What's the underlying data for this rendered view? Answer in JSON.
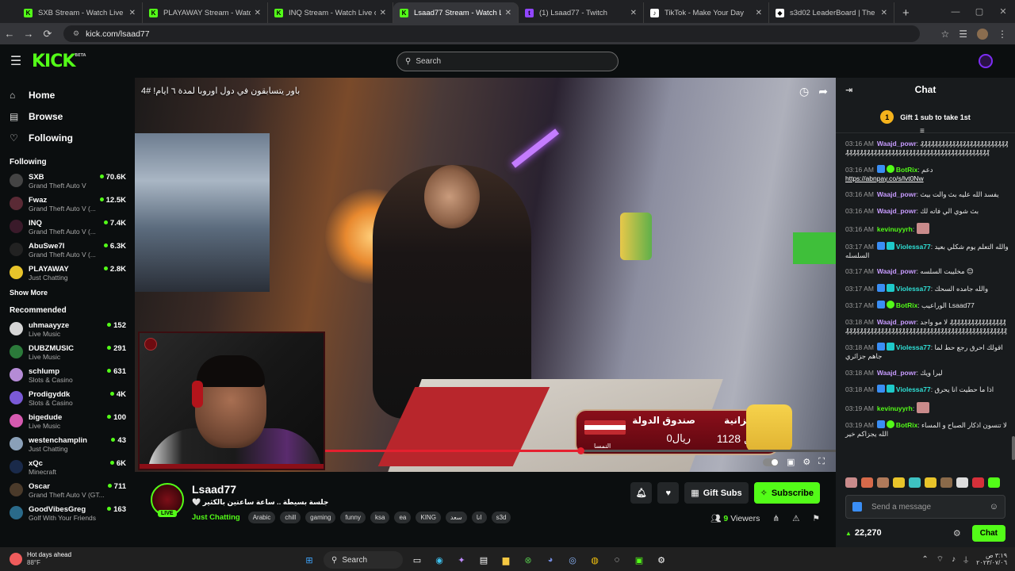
{
  "browser": {
    "tabs": [
      {
        "title": "SXB Stream - Watch Live on Kick",
        "fav": "K",
        "color": "#53fc18"
      },
      {
        "title": "PLAYAWAY Stream - Watch Live on Kick",
        "fav": "K",
        "color": "#53fc18"
      },
      {
        "title": "INQ Stream - Watch Live on Kick",
        "fav": "K",
        "color": "#53fc18"
      },
      {
        "title": "Lsaad77 Stream - Watch Live on Kick",
        "fav": "K",
        "color": "#53fc18"
      },
      {
        "title": "(1) Lsaad77 - Twitch",
        "fav": "t",
        "color": "#9146ff"
      },
      {
        "title": "TikTok - Make Your Day",
        "fav": "♪",
        "color": "#ffffff"
      },
      {
        "title": "s3d02 LeaderBoard | The best Leaderboard",
        "fav": "◆",
        "color": "#ffffff"
      }
    ],
    "url": "kick.com/lsaad77"
  },
  "header": {
    "logo": "KICK",
    "logo_beta": "BETA",
    "search_placeholder": "Search"
  },
  "sidebar": {
    "nav": [
      {
        "label": "Home",
        "icon": "home-icon"
      },
      {
        "label": "Browse",
        "icon": "browse-icon"
      },
      {
        "label": "Following",
        "icon": "heart-icon"
      }
    ],
    "following_title": "Following",
    "following": [
      {
        "name": "SXB",
        "category": "Grand Theft Auto V",
        "viewers": "70.6K",
        "color": "#444"
      },
      {
        "name": "Fwaz",
        "category": "Grand Theft Auto V (...",
        "viewers": "12.5K",
        "color": "#5a2a35"
      },
      {
        "name": "INQ",
        "category": "Grand Theft Auto V (...",
        "viewers": "7.4K",
        "color": "#3a1a2a"
      },
      {
        "name": "AbuSwe7l",
        "category": "Grand Theft Auto V (...",
        "viewers": "6.3K",
        "color": "#222"
      },
      {
        "name": "PLAYAWAY",
        "category": "Just Chatting",
        "viewers": "2.8K",
        "color": "#e8c42a"
      }
    ],
    "show_more": "Show More",
    "recommended_title": "Recommended",
    "recommended": [
      {
        "name": "uhmaayyze",
        "category": "Live Music",
        "viewers": "152",
        "color": "#d6d6d6"
      },
      {
        "name": "DUBZMUSIC",
        "category": "Live Music",
        "viewers": "291",
        "color": "#2b7a3a"
      },
      {
        "name": "schlump",
        "category": "Slots & Casino",
        "viewers": "631",
        "color": "#b58bd6"
      },
      {
        "name": "Prodigyddk",
        "category": "Slots & Casino",
        "viewers": "4K",
        "color": "#7a5ad6"
      },
      {
        "name": "bigedude",
        "category": "Live Music",
        "viewers": "100",
        "color": "#d65ab0"
      },
      {
        "name": "westenchamplin",
        "category": "Just Chatting",
        "viewers": "43",
        "color": "#8aa0b8"
      },
      {
        "name": "xQc",
        "category": "Minecraft",
        "viewers": "6K",
        "color": "#1a2a4a"
      },
      {
        "name": "Oscar",
        "category": "Grand Theft Auto V (GT...",
        "viewers": "711",
        "color": "#4a3a2a"
      },
      {
        "name": "GoodVibesGreg",
        "category": "Golf With Your Friends",
        "viewers": "163",
        "color": "#2a6a8a"
      }
    ]
  },
  "video": {
    "title": "باور يتسابقون في دول اوروبا لمدة ٦ ايام! #4",
    "overlay": {
      "treasury_label": "صندوق الدولة",
      "budget_label": "الميزانية",
      "treasury_value": "0ريال",
      "budget_value": "1128 ريال",
      "country": "النمسا"
    },
    "progress": 0.5
  },
  "stream": {
    "name": "Lsaad77",
    "live": "LIVE",
    "title": "جلسة بسيطة .. ساعة ساعتين بالكثير 🤍",
    "category": "Just Chatting",
    "tags": [
      "Arabic",
      "chill",
      "gaming",
      "funny",
      "ksa",
      "ea",
      "KING",
      "سعد",
      "انا",
      "s3d"
    ],
    "gift_label": "Gift Subs",
    "subscribe_label": "Subscribe",
    "viewers_count": "9",
    "viewers_label": "Viewers"
  },
  "chat": {
    "title": "Chat",
    "gift_badge": "1",
    "gift_text": "Gift 1 sub to take 1st",
    "messages": [
      {
        "time": "03:16 AM",
        "user": "Waajd_powr",
        "color": "#c79bff",
        "text": "₰₰₰₰₰₰₰₰₰₰₰₰₰₰₰₰₰₰₰₰₰₰₰₰₰₰₰₰₰₰₰₰₰₰₰₰₰₰₰₰₰₰₰₰₰₰₰₰₰₰₰₰₰₰₰₰₰₰₰₰₰₰₰₰₰₰",
        "badges": ""
      },
      {
        "time": "03:16 AM",
        "user": "BotRix",
        "color": "#53fc18",
        "text": "دعم",
        "link": "https://abnpay.co/s/lvt0Nw",
        "badges": "bot"
      },
      {
        "time": "03:16 AM",
        "user": "Waajd_powr",
        "color": "#c79bff",
        "text": "يفسد الله عليه بث والت بيث",
        "badges": ""
      },
      {
        "time": "03:16 AM",
        "user": "Waajd_powr",
        "color": "#c79bff",
        "text": "بث شوي الي فاته لك",
        "badges": ""
      },
      {
        "time": "03:16 AM",
        "user": "kevinuyyrh",
        "color": "#53fc18",
        "text": "",
        "emote": true,
        "badges": ""
      },
      {
        "time": "03:17 AM",
        "user": "Violessa77",
        "color": "#2fe0d6",
        "text": "والله التعلم يوم شكلي بعيد السلسله",
        "badges": "sub"
      },
      {
        "time": "03:17 AM",
        "user": "Waajd_powr",
        "color": "#c79bff",
        "text": "مخليبت السلسه 😊",
        "badges": ""
      },
      {
        "time": "03:17 AM",
        "user": "Violessa77",
        "color": "#2fe0d6",
        "text": "والله جامده السحك",
        "badges": "sub"
      },
      {
        "time": "03:17 AM",
        "user": "BotRix",
        "color": "#53fc18",
        "text": "الوراعيب Lsaad77",
        "badges": "bot"
      },
      {
        "time": "03:18 AM",
        "user": "Waajd_powr",
        "color": "#c79bff",
        "text": "لا مو واجد ₰₰₰₰₰₰₰₰₰₰₰₰₰₰₰₰₰₰₰₰₰₰₰₰₰₰₰₰₰₰₰₰₰₰₰₰₰₰₰₰₰₰₰₰₰₰₰₰₰₰₰₰₰₰₰₰₰₰₰₰₰₰",
        "badges": ""
      },
      {
        "time": "03:18 AM",
        "user": "Violessa77",
        "color": "#2fe0d6",
        "text": "اقولك احرق رجع حط لما جاهم جزائري",
        "badges": "sub"
      },
      {
        "time": "03:18 AM",
        "user": "Waajd_powr",
        "color": "#c79bff",
        "text": "ليرا ويك",
        "badges": ""
      },
      {
        "time": "03:18 AM",
        "user": "Violessa77",
        "color": "#2fe0d6",
        "text": "اذا ما حطيت انا يحرق",
        "badges": "sub"
      },
      {
        "time": "03:19 AM",
        "user": "kevinuyyrh",
        "color": "#53fc18",
        "text": "",
        "emote": true,
        "badges": ""
      },
      {
        "time": "03:19 AM",
        "user": "BotRix",
        "color": "#53fc18",
        "text": "لا تنسون اذكار الصباح و المساء الله يجزاكم خير",
        "badges": "bot"
      }
    ],
    "input_placeholder": "Send a message",
    "points": "22,270",
    "chat_button": "Chat"
  },
  "taskbar": {
    "weather_title": "Hot days ahead",
    "weather_temp": "88°F",
    "search": "Search",
    "time": "٣:١٩ ص",
    "date": "٢٠٢٣/٠٧/٠٦"
  }
}
